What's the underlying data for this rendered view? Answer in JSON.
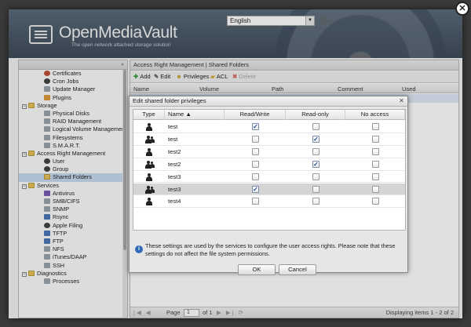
{
  "app": {
    "title": "OpenMediaVault",
    "subtitle": "The open network attached storage solution"
  },
  "header": {
    "language": "English"
  },
  "sidebar": {
    "collapse_glyph": "«",
    "items": [
      {
        "label": "Certificates",
        "level": "sub",
        "icon": "red"
      },
      {
        "label": "Cron Jobs",
        "level": "sub",
        "icon": "dark"
      },
      {
        "label": "Update Manager",
        "level": "sub",
        "icon": "gray"
      },
      {
        "label": "Plugins",
        "level": "sub",
        "icon": "orange"
      },
      {
        "label": "Storage",
        "level": "cat",
        "icon": "folder"
      },
      {
        "label": "Physical Disks",
        "level": "sub",
        "icon": "gray"
      },
      {
        "label": "RAID Management",
        "level": "sub",
        "icon": "gray"
      },
      {
        "label": "Logical Volume Management",
        "level": "sub",
        "icon": "gray"
      },
      {
        "label": "Filesystems",
        "level": "sub",
        "icon": "gray"
      },
      {
        "label": "S.M.A.R.T.",
        "level": "sub",
        "icon": "gray"
      },
      {
        "label": "Access Right Management",
        "level": "cat",
        "icon": "folder"
      },
      {
        "label": "User",
        "level": "sub",
        "icon": "dark"
      },
      {
        "label": "Group",
        "level": "sub",
        "icon": "dark"
      },
      {
        "label": "Shared Folders",
        "level": "sub",
        "icon": "folder",
        "selected": true
      },
      {
        "label": "Services",
        "level": "cat",
        "icon": "folder"
      },
      {
        "label": "Antivirus",
        "level": "sub",
        "icon": "purple"
      },
      {
        "label": "SMB/CIFS",
        "level": "sub",
        "icon": "gray"
      },
      {
        "label": "SNMP",
        "level": "sub",
        "icon": "gray"
      },
      {
        "label": "Rsync",
        "level": "sub",
        "icon": "blue"
      },
      {
        "label": "Apple Filing",
        "level": "sub",
        "icon": "dark"
      },
      {
        "label": "TFTP",
        "level": "sub",
        "icon": "blue"
      },
      {
        "label": "FTP",
        "level": "sub",
        "icon": "blue"
      },
      {
        "label": "NFS",
        "level": "sub",
        "icon": "gray"
      },
      {
        "label": "iTunes/DAAP",
        "level": "sub",
        "icon": "gray"
      },
      {
        "label": "SSH",
        "level": "sub",
        "icon": "gray"
      },
      {
        "label": "Diagnostics",
        "level": "cat",
        "icon": "folder"
      },
      {
        "label": "Processes",
        "level": "sub",
        "icon": "gray"
      }
    ]
  },
  "main": {
    "breadcrumb": "Access Right Management | Shared Folders",
    "toolbar": {
      "add": "Add",
      "edit": "Edit",
      "privileges": "Privileges",
      "acl": "ACL",
      "delete": "Delete"
    },
    "columns": [
      "Name",
      "Volume",
      "Path",
      "Comment",
      "Used"
    ],
    "pager": {
      "page_label": "Page",
      "page_value": "1",
      "of_label": "of 1",
      "display": "Displaying items 1 - 2 of 2"
    }
  },
  "dialog": {
    "title": "Edit shared folder privileges",
    "columns": {
      "type": "Type",
      "name": "Name ▲",
      "readwrite": "Read/Write",
      "readonly": "Read-only",
      "noaccess": "No access"
    },
    "rows": [
      {
        "type": "user",
        "name": "test",
        "rw": true,
        "ro": false,
        "na": false,
        "selected": false
      },
      {
        "type": "group",
        "name": "test",
        "rw": false,
        "ro": true,
        "na": false,
        "selected": false
      },
      {
        "type": "user",
        "name": "test2",
        "rw": false,
        "ro": false,
        "na": false,
        "selected": false
      },
      {
        "type": "group",
        "name": "test2",
        "rw": false,
        "ro": true,
        "na": false,
        "selected": false
      },
      {
        "type": "user",
        "name": "test3",
        "rw": false,
        "ro": false,
        "na": false,
        "selected": false
      },
      {
        "type": "group",
        "name": "test3",
        "rw": true,
        "ro": false,
        "na": false,
        "selected": true
      },
      {
        "type": "user",
        "name": "test4",
        "rw": false,
        "ro": false,
        "na": false,
        "selected": false
      }
    ],
    "note": "These settings are used by the services to configure the user access rights. Please note that these settings do not affect the file system permissions.",
    "ok": "OK",
    "cancel": "Cancel"
  },
  "colors": {
    "header_bg": "#3e4c59",
    "selection": "#c8daf0",
    "info_blue": "#2e6ab8"
  }
}
